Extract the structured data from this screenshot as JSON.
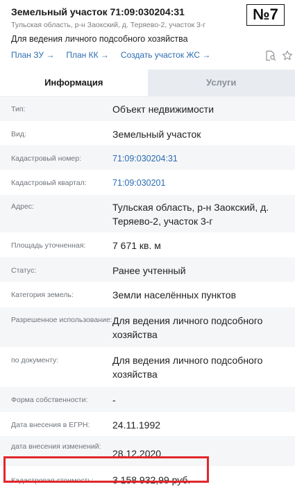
{
  "header": {
    "title": "Земельный участок 71:09:030204:31",
    "address_short": "Тульская область, р-н Заокский, д. Теряево-2, участок 3-г",
    "purpose": "Для ведения личного подсобного хозяйства",
    "links": [
      "План ЗУ →",
      "План КК →",
      "Создать участок ЖС →"
    ]
  },
  "badge": "№7",
  "icons": {
    "search": "search-document-icon",
    "favorite": "star-icon"
  },
  "tabs": [
    "Информация",
    "Услуги"
  ],
  "rows": [
    {
      "label": "Тип:",
      "value": "Объект недвижимости"
    },
    {
      "label": "Вид:",
      "value": "Земельный участок"
    },
    {
      "label": "Кадастровый номер:",
      "value": "71:09:030204:31"
    },
    {
      "label": "Кадастровый квартал:",
      "value": "71:09:030201"
    },
    {
      "label": "Адрес:",
      "value": "Тульская область, р-н Заокский, д. Теряево-2, участок 3-г"
    },
    {
      "label": "Площадь уточненная:",
      "value": "7 671 кв. м"
    },
    {
      "label": "Статус:",
      "value": "Ранее учтенный"
    },
    {
      "label": "Категория земель:",
      "value": "Земли населённых пунктов"
    },
    {
      "label": "Разрешенное использование:",
      "value": "Для ведения личного подсобного хозяйства"
    },
    {
      "label": "по документу:",
      "value": "Для ведения личного подсобного хозяйства"
    },
    {
      "label": "Форма собственности:",
      "value": "-"
    },
    {
      "label": "Дата внесения в ЕГРН:",
      "value": "24.11.1992"
    },
    {
      "label": "дата внесения изменений:",
      "value": "28.12.2020"
    },
    {
      "label": "Кадастровая стоимость:",
      "value": "3 158 932,99 руб."
    }
  ],
  "colors": {
    "link": "#2b6cb0",
    "highlight": "#e2262b",
    "row_shade": "#f5f6f8",
    "tab_inactive": "#e8ebef"
  }
}
